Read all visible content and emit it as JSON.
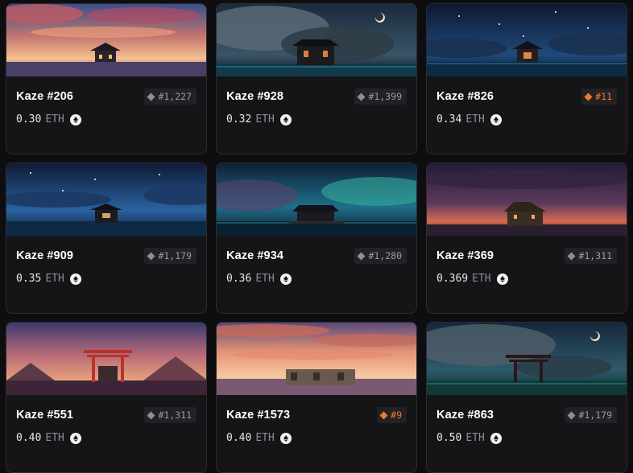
{
  "currency": "ETH",
  "cards": [
    {
      "name": "Kaze #206",
      "rank": "#1,227",
      "top": false,
      "price": "0.30",
      "scene": "sunset-pagoda"
    },
    {
      "name": "Kaze #928",
      "rank": "#1,399",
      "top": false,
      "price": "0.32",
      "scene": "storm-shrine-moon"
    },
    {
      "name": "Kaze #826",
      "rank": "#11",
      "top": true,
      "price": "0.34",
      "scene": "starry-shrine"
    },
    {
      "name": "Kaze #909",
      "rank": "#1,179",
      "top": false,
      "price": "0.35",
      "scene": "starry-shrine-blue"
    },
    {
      "name": "Kaze #934",
      "rank": "#1,280",
      "top": false,
      "price": "0.36",
      "scene": "teal-sky-house"
    },
    {
      "name": "Kaze #369",
      "rank": "#1,311",
      "top": false,
      "price": "0.369",
      "scene": "dusk-house"
    },
    {
      "name": "Kaze #551",
      "rank": "#1,311",
      "top": false,
      "price": "0.40",
      "scene": "torii-mountains"
    },
    {
      "name": "Kaze #1573",
      "rank": "#9",
      "top": true,
      "price": "0.40",
      "scene": "sunset-ruins"
    },
    {
      "name": "Kaze #863",
      "rank": "#1,179",
      "top": false,
      "price": "0.50",
      "scene": "torii-moon"
    }
  ],
  "colors": {
    "accent_rank": "#f07a2b",
    "rank_gray": "#8e8e96",
    "card_bg": "#151518"
  }
}
